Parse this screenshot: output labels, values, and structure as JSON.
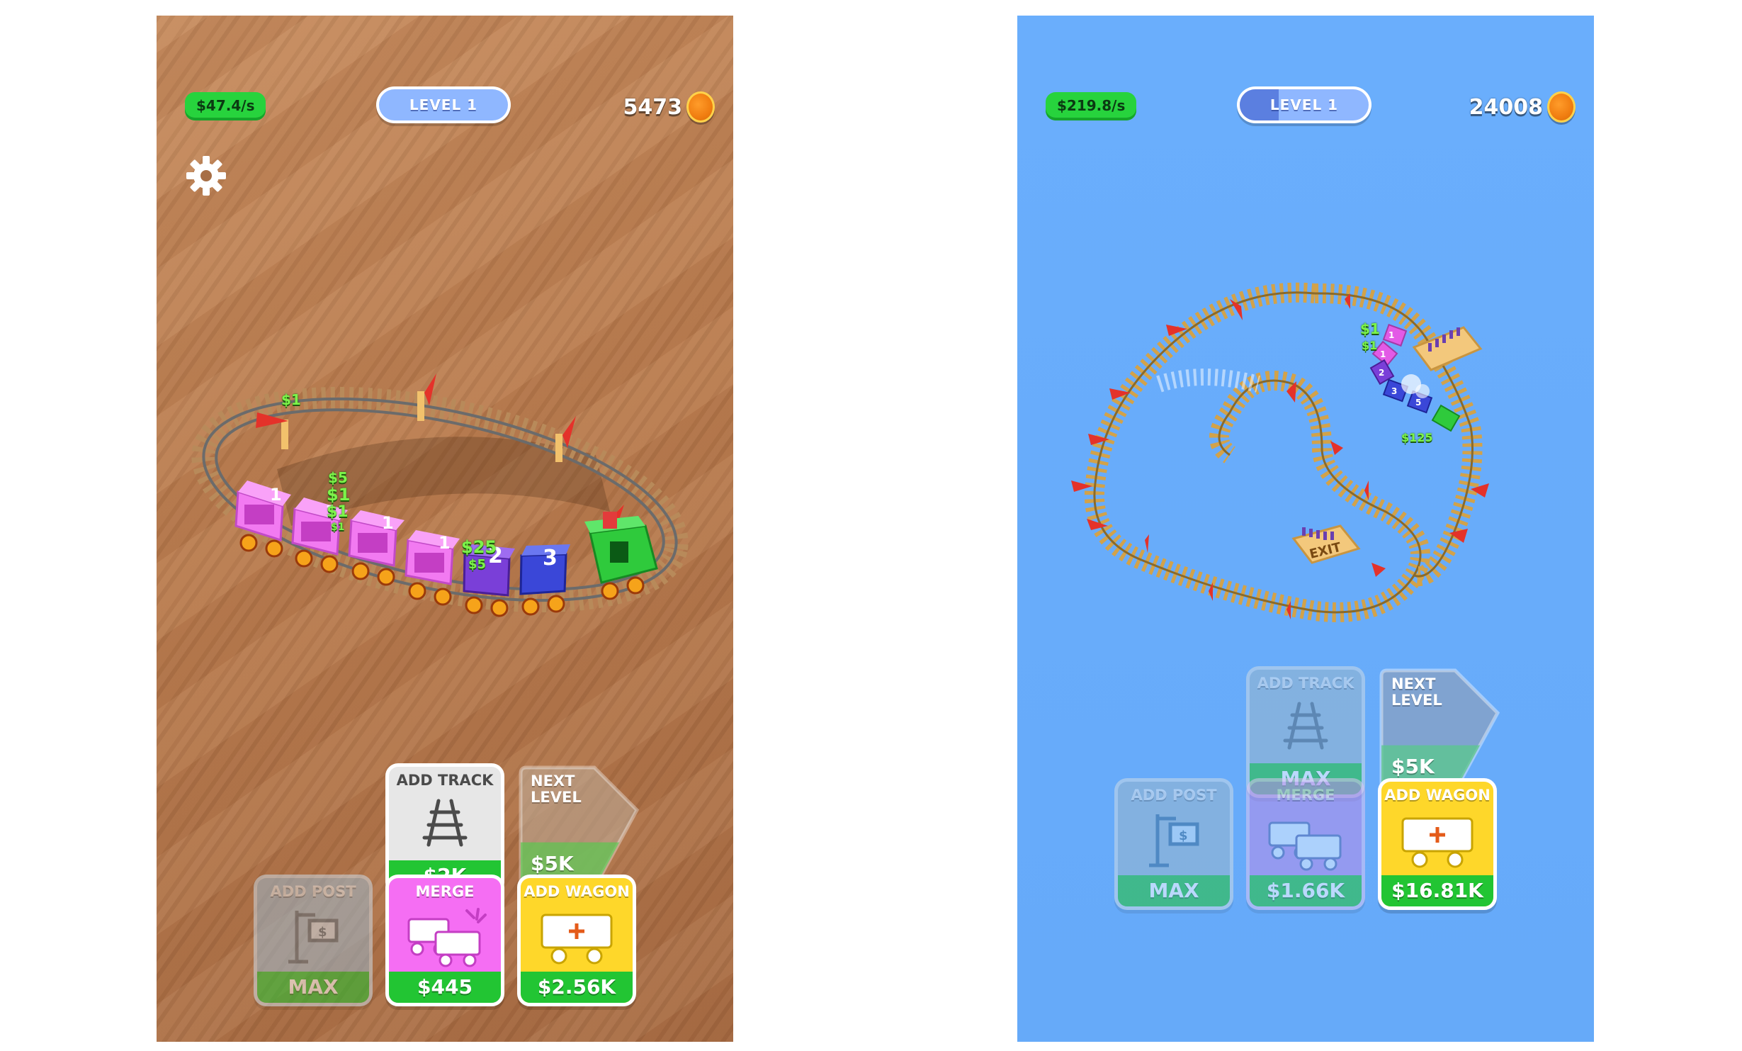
{
  "screens": [
    {
      "id": "left",
      "hud": {
        "income_rate": "$47.4/s",
        "level_label": "LEVEL 1",
        "level_progress": 0.0,
        "coins": "5473"
      },
      "floating_money": [
        "$1",
        "$5",
        "$1",
        "$1",
        "$1",
        "$25",
        "$5"
      ],
      "wagon_numbers": [
        "1",
        "1",
        "1",
        "1",
        "2",
        "3"
      ],
      "buttons": {
        "add_track": {
          "title": "ADD TRACK",
          "price": "$2K"
        },
        "next_level": {
          "title": "NEXT LEVEL",
          "price": "$5K",
          "progress": 0.4
        },
        "add_post": {
          "title": "ADD POST",
          "price": "MAX"
        },
        "merge": {
          "title": "MERGE",
          "price": "$445"
        },
        "add_wagon": {
          "title": "ADD WAGON",
          "price": "$2.56K"
        }
      }
    },
    {
      "id": "right",
      "hud": {
        "income_rate": "$219.8/s",
        "level_label": "LEVEL 1",
        "level_progress": 0.3,
        "coins": "24008"
      },
      "floating_money": [
        "$1",
        "$1",
        "$125"
      ],
      "station_sign": "EXIT",
      "wagon_numbers": [
        "1",
        "1",
        "2",
        "3",
        "5"
      ],
      "buttons": {
        "add_track": {
          "title": "ADD TRACK",
          "price": "MAX"
        },
        "next_level": {
          "title": "NEXT LEVEL",
          "price": "$5K",
          "progress": 0.4
        },
        "add_post": {
          "title": "ADD POST",
          "price": "MAX"
        },
        "merge": {
          "title": "MERGE",
          "price": "$1.66K"
        },
        "add_wagon": {
          "title": "ADD WAGON",
          "price": "$16.81K"
        }
      }
    }
  ],
  "icons": {
    "settings": "gear-icon",
    "coin": "coin-icon",
    "track": "track-icon",
    "post": "money-post-icon",
    "merge": "merge-wagons-icon",
    "wagon": "add-wagon-icon"
  },
  "colors": {
    "green": "#22c533",
    "pink": "#f56ef3",
    "yellow": "#fed72a",
    "wood": "#b87a4d",
    "sky": "#68acfb"
  }
}
